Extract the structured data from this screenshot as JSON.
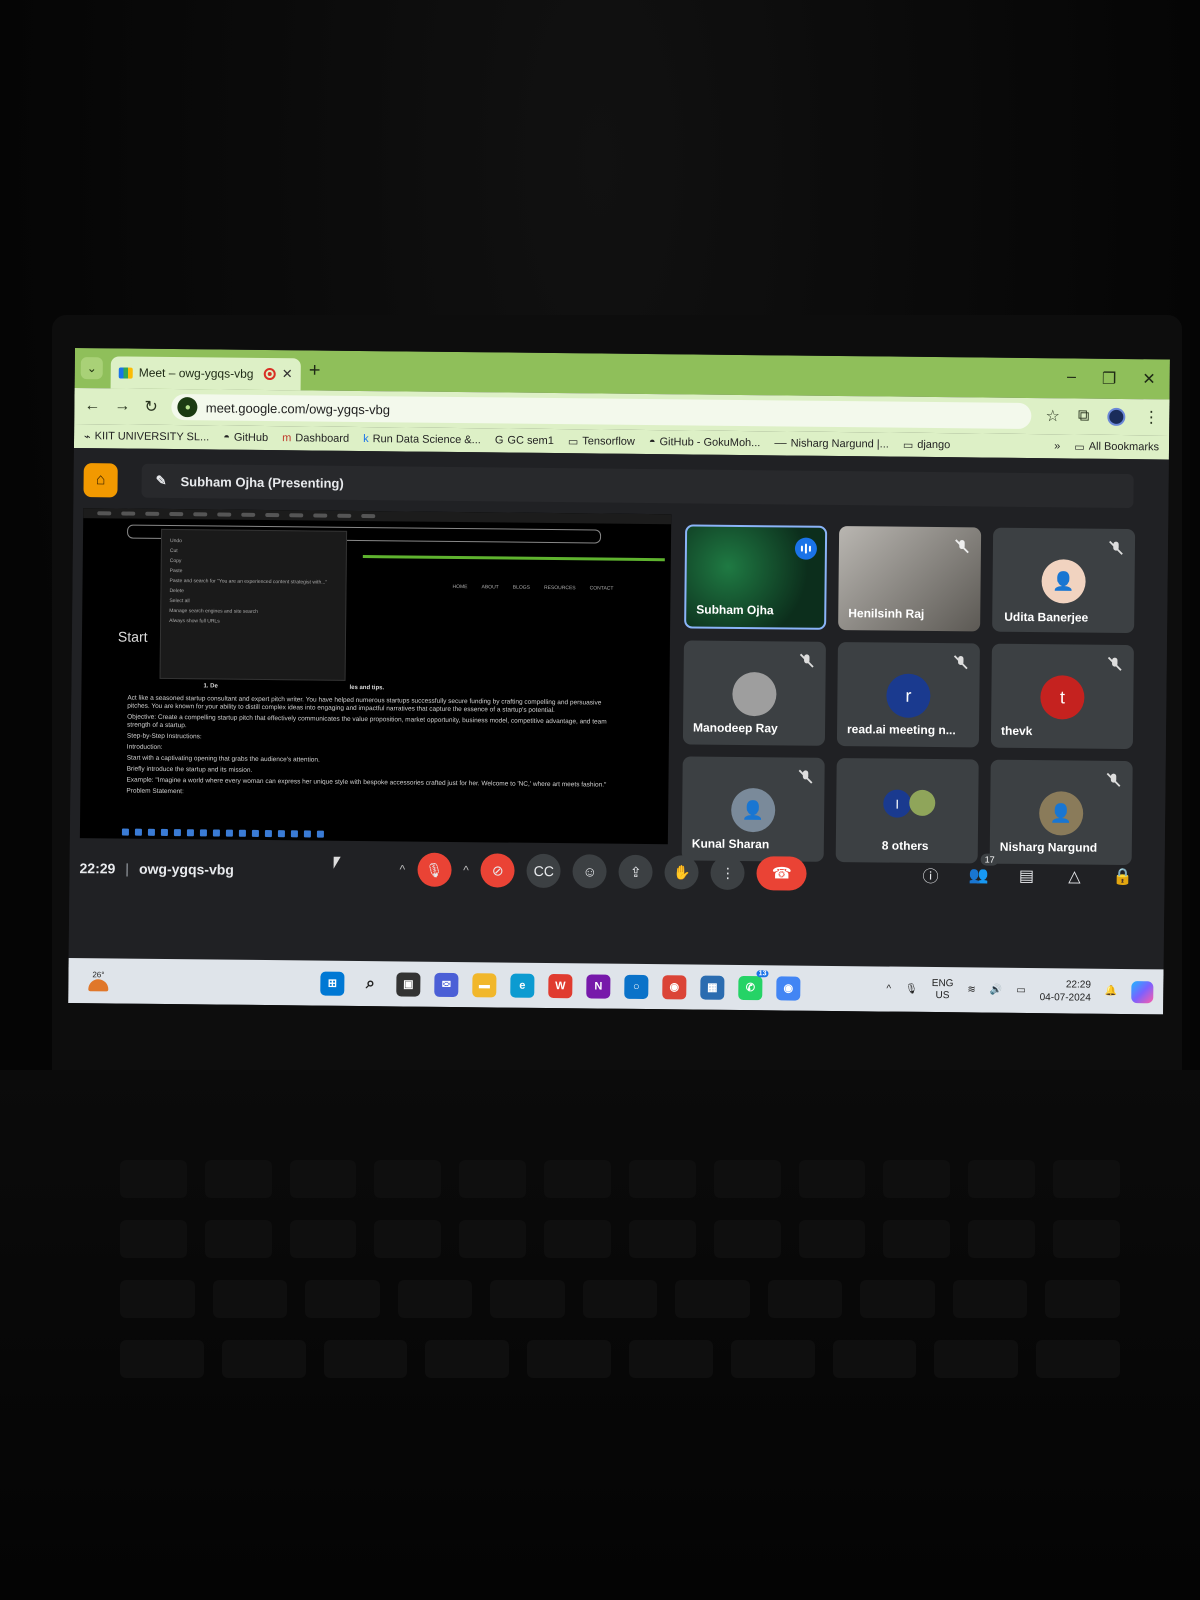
{
  "browser": {
    "tab_title": "Meet – owg-ygqs-vbg",
    "url": "meet.google.com/owg-ygqs-vbg",
    "bookmarks": [
      {
        "icon": "kiit-icon",
        "label": "KIIT UNIVERSITY SL..."
      },
      {
        "icon": "github-icon",
        "label": "GitHub"
      },
      {
        "icon": "dashboard-icon",
        "label": "Dashboard"
      },
      {
        "icon": "kaggle-icon",
        "label": "Run Data Science &..."
      },
      {
        "icon": "google-icon",
        "label": "GC sem1"
      },
      {
        "icon": "folder-icon",
        "label": "Tensorflow"
      },
      {
        "icon": "github-icon",
        "label": "GitHub - GokuMoh..."
      },
      {
        "icon": "link-icon",
        "label": "Nisharg Nargund |..."
      },
      {
        "icon": "folder-icon",
        "label": "django"
      }
    ],
    "more_bookmarks": "»",
    "all_bookmarks": "All Bookmarks",
    "accent": "#8fbf5a"
  },
  "meet": {
    "presenter_title": "Subham Ojha (Presenting)",
    "time": "22:29",
    "meeting_code": "owg-ygqs-vbg",
    "people_count": "17",
    "participants": [
      {
        "name": "Subham Ojha",
        "kind": "video",
        "speaking": true
      },
      {
        "name": "Henilsinh Raj",
        "kind": "video",
        "muted": true
      },
      {
        "name": "Udita Banerjee",
        "kind": "avatar",
        "avatar_color": "#f1d3c0",
        "muted": true
      },
      {
        "name": "Manodeep Ray",
        "kind": "avatar",
        "avatar_color": "#9e9e9e",
        "muted": true
      },
      {
        "name": "read.ai meeting n...",
        "kind": "initial",
        "initial": "r",
        "avatar_color": "#1a3a8f",
        "muted": true
      },
      {
        "name": "thevk",
        "kind": "initial",
        "initial": "t",
        "avatar_color": "#c5221f",
        "muted": true
      },
      {
        "name": "Kunal Sharan",
        "kind": "avatar",
        "avatar_color": "#7a8a9a",
        "muted": true
      },
      {
        "name": "8 others",
        "kind": "group",
        "initial": "I",
        "avatar_color": "#1a3a8f"
      },
      {
        "name": "Nisharg Nargund",
        "kind": "avatar",
        "avatar_color": "#8a7b5a",
        "muted": true
      }
    ]
  },
  "shared_screen": {
    "heading": "Start",
    "nav": [
      "HOME",
      "ABOUT",
      "BLOGS",
      "RESOURCES",
      "CONTACT"
    ],
    "section": "1. De",
    "section_tail": "les and tips.",
    "menu_items": [
      "Undo",
      "Cut",
      "Copy",
      "Paste",
      "Paste and search for \"You are an experienced content strategist with...\"",
      "Delete",
      "Select all",
      "Manage search engines and site search",
      "Always show full URLs"
    ],
    "paragraphs": [
      "Act like a seasoned startup consultant and expert pitch writer. You have helped numerous startups successfully secure funding by crafting compelling and persuasive pitches. You are known for your ability to distill complex ideas into engaging and impactful narratives that capture the essence of a startup's potential.",
      "Objective: Create a compelling startup pitch that effectively communicates the value proposition, market opportunity, business model, competitive advantage, and team strength of a startup.",
      "Step-by-Step Instructions:",
      "Introduction:",
      "Start with a captivating opening that grabs the audience's attention.",
      "Briefly introduce the startup and its mission.",
      "Example: \"Imagine a world where every woman can express her unique style with bespoke accessories crafted just for her. Welcome to 'NC,' where art meets fashion.\"",
      "Problem Statement:"
    ]
  },
  "taskbar": {
    "temperature": "26°",
    "lang": "ENG",
    "region": "US",
    "time": "22:29",
    "date": "04-07-2024",
    "whatsapp_badge": "13",
    "apps": [
      {
        "name": "start-icon",
        "color": "#0078d4",
        "glyph": "⊞"
      },
      {
        "name": "search-icon",
        "color": "transparent",
        "glyph": "⌕"
      },
      {
        "name": "task-view-icon",
        "color": "#333",
        "glyph": "▣"
      },
      {
        "name": "chat-icon",
        "color": "#4b5fd6",
        "glyph": "✉"
      },
      {
        "name": "file-explorer-icon",
        "color": "#f1b72b",
        "glyph": "▬"
      },
      {
        "name": "edge-icon",
        "color": "#0c9bd1",
        "glyph": "e"
      },
      {
        "name": "wps-icon",
        "color": "#e03b2f",
        "glyph": "W"
      },
      {
        "name": "onenote-icon",
        "color": "#7719aa",
        "glyph": "N"
      },
      {
        "name": "cortana-icon",
        "color": "#0a72c9",
        "glyph": "○"
      },
      {
        "name": "chrome-icon",
        "color": "#db4437",
        "glyph": "◉"
      },
      {
        "name": "store-icon",
        "color": "#2b6cb0",
        "glyph": "▦"
      },
      {
        "name": "whatsapp-icon",
        "color": "#25d366",
        "glyph": "✆"
      },
      {
        "name": "chrome-profile-icon",
        "color": "#4285f4",
        "glyph": "◉"
      }
    ]
  }
}
